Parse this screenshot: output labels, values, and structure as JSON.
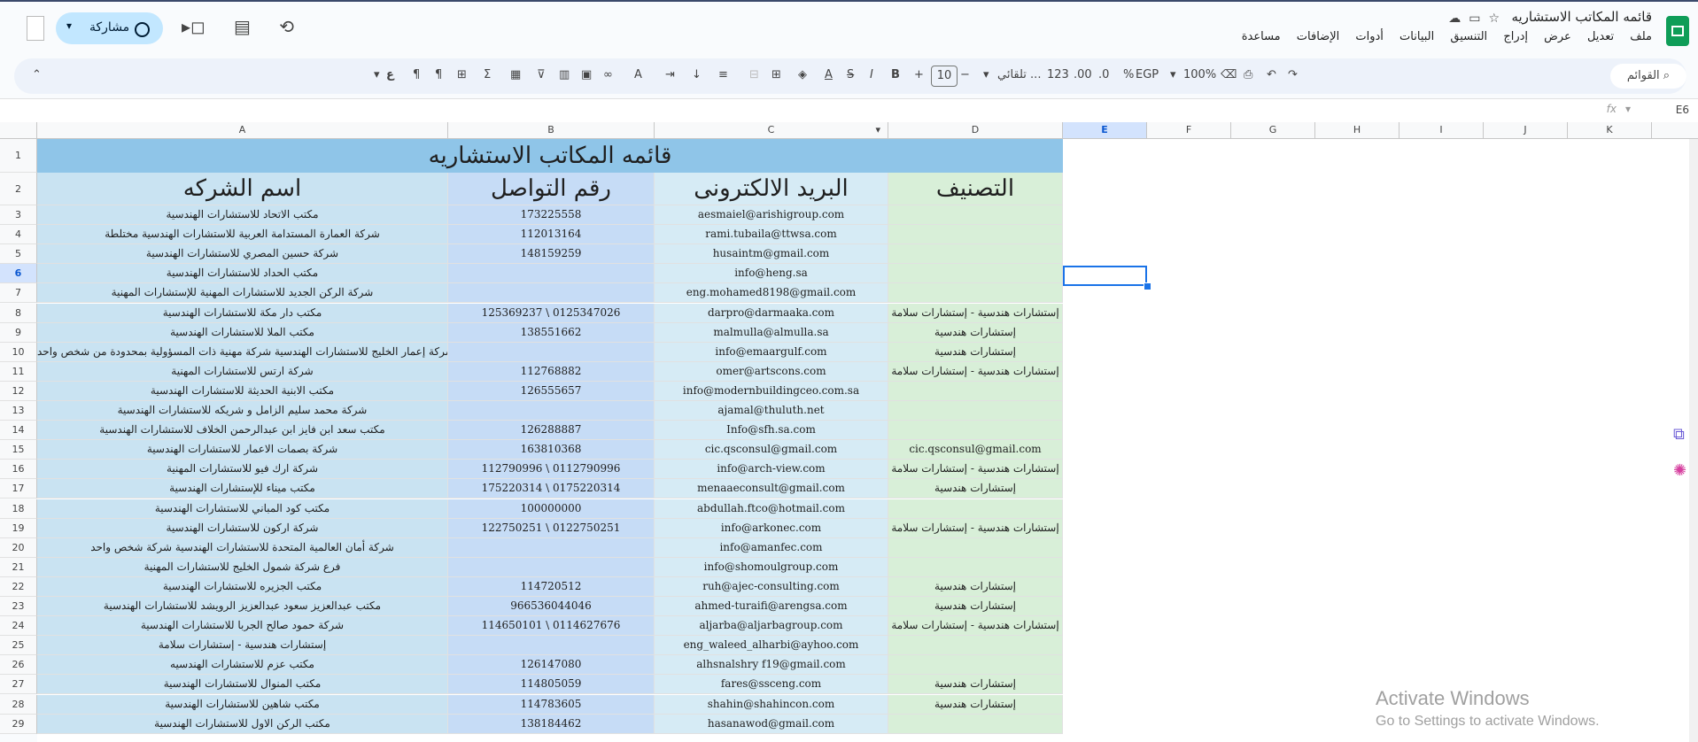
{
  "app": {
    "doc_title": "قائمه المكاتب الاستشاريه",
    "menus": [
      "ملف",
      "تعديل",
      "عرض",
      "إدراج",
      "التنسيق",
      "البيانات",
      "أدوات",
      "الإضافات",
      "مساعدة"
    ],
    "share_label": "مشاركة"
  },
  "toolbar": {
    "search_label": "القوائم",
    "zoom": "100%",
    "currency": "EGP",
    "percent": "%",
    "decimal_dec": ".0",
    "decimal_inc": ".00",
    "number_format": "123",
    "font": "تلقائي ...",
    "font_size": "10",
    "bold": "B",
    "italic": "I",
    "strike": "S",
    "text_color": "A",
    "sigma": "Σ",
    "plus": "+",
    "minus": "−"
  },
  "formula_bar": {
    "cell_ref": "E6",
    "fx": "fx"
  },
  "columns": [
    "A",
    "B",
    "C",
    "D",
    "E",
    "F",
    "G",
    "H",
    "I",
    "J",
    "K"
  ],
  "sheet": {
    "title": "قائمه المكاتب الاستشاريه",
    "headers": {
      "company": "اسم الشركه",
      "phone": "رقم التواصل",
      "email": "البريد الالكترونى",
      "category": "التصنيف"
    },
    "rows": [
      {
        "n": "3",
        "a": "مكتب الاتحاد للاستشارات الهندسية",
        "b": "173225558",
        "c": "aesmaiel@arishigroup.com",
        "d": ""
      },
      {
        "n": "4",
        "a": "شركة العمارة المستدامة العربية للاستشارات الهندسية مختلطة",
        "b": "112013164",
        "c": "rami.tubaila@ttwsa.com",
        "d": ""
      },
      {
        "n": "5",
        "a": "شركة حسين المصري للاستشارات الهندسية",
        "b": "148159259",
        "c": "husaintm@gmail.com",
        "d": ""
      },
      {
        "n": "6",
        "a": "مكتب الحداد للاستشارات الهندسية",
        "b": "",
        "c": "info@heng.sa",
        "d": ""
      },
      {
        "n": "7",
        "a": "شركة الركن الجديد للاستشارات المهنية للإستشارات المهنية",
        "b": "",
        "c": "eng.mohamed8198@gmail.com",
        "d": ""
      },
      {
        "n": "8",
        "a": "مكتب دار مكة للاستشارات الهندسية",
        "b": "125369237 \\ 0125347026",
        "c": "darpro@darmaaka.com",
        "d": "إستشارات هندسية - إستشارات سلامة"
      },
      {
        "n": "9",
        "a": "مكتب الملا للاستشارات الهندسية",
        "b": "138551662",
        "c": "malmulla@almulla.sa",
        "d": "إستشارات هندسية"
      },
      {
        "n": "10",
        "a": "شركة إعمار الخليج للاستشارات الهندسية شركة مهنية ذات المسؤولية بمحدودة من شخص واحد",
        "b": "",
        "c": "info@emaargulf.com",
        "d": "إستشارات هندسية"
      },
      {
        "n": "11",
        "a": "شركة ارتس للاستشارات المهنية",
        "b": "112768882",
        "c": "omer@artscons.com",
        "d": "إستشارات هندسية - إستشارات سلامة"
      },
      {
        "n": "12",
        "a": "مكتب الابنية الحديثة للاستشارات الهندسية",
        "b": "126555657",
        "c": "info@modernbuildingceo.com.sa",
        "d": ""
      },
      {
        "n": "13",
        "a": "شركة محمد سليم الزامل و شريكه للاستشارات الهندسية",
        "b": "",
        "c": "ajamal@thuluth.net",
        "d": ""
      },
      {
        "n": "14",
        "a": "مكتب سعد ابن فايز ابن عبدالرحمن الخلاف للاستشارات الهندسية",
        "b": "126288887",
        "c": "Info@sfh.sa.com",
        "d": ""
      },
      {
        "n": "15",
        "a": "شركة بصمات الاعمار للاستشارات الهندسية",
        "b": "163810368",
        "c": "cic.qsconsul@gmail.com",
        "d": "cic.qsconsul@gmail.com"
      },
      {
        "n": "16",
        "a": "شركة ارك فيو للاستشارات المهنية",
        "b": "112790996 \\ 0112790996",
        "c": "info@arch-view.com",
        "d": "إستشارات هندسية - إستشارات سلامة"
      },
      {
        "n": "17",
        "a": "مكتب ميناء للإستشارات الهندسية",
        "b": "175220314 \\ 0175220314",
        "c": "menaaeconsult@gmail.com",
        "d": "إستشارات هندسية"
      },
      {
        "n": "18",
        "a": "مكتب كود المباني للاستشارات الهندسية",
        "b": "100000000",
        "c": "abdullah.ftco@hotmail.com",
        "d": ""
      },
      {
        "n": "19",
        "a": "شركة اركون للاستشارات الهندسية",
        "b": "122750251 \\ 0122750251",
        "c": "info@arkonec.com",
        "d": "إستشارات هندسية - إستشارات سلامة"
      },
      {
        "n": "20",
        "a": "شركة أمان العالمية المتحدة للاستشارات الهندسية شركة شخص واحد",
        "b": "",
        "c": "info@amanfec.com",
        "d": ""
      },
      {
        "n": "21",
        "a": "فرع شركة شمول الخليج للاستشارات المهنية",
        "b": "",
        "c": "info@shomoulgroup.com",
        "d": ""
      },
      {
        "n": "22",
        "a": "مكتب الجزيره للاستشارات الهندسية",
        "b": "114720512",
        "c": "ruh@ajec-consulting.com",
        "d": "إستشارات هندسية"
      },
      {
        "n": "23",
        "a": "مكتب عبدالعزيز سعود عبدالعزيز الرويشد للاستشارات الهندسية",
        "b": "966536044046",
        "c": "ahmed-turaifi@arengsa.com",
        "d": "إستشارات هندسية"
      },
      {
        "n": "24",
        "a": "شركة حمود صالح الجربا للاستشارات الهندسية",
        "b": "114650101 \\ 0114627676",
        "c": "aljarba@aljarbagroup.com",
        "d": "إستشارات هندسية - إستشارات سلامة"
      },
      {
        "n": "25",
        "a": "إستشارات هندسية - إستشارات سلامة",
        "b": "",
        "c": "eng_waleed_alharbi@ayhoo.com",
        "d": ""
      },
      {
        "n": "26",
        "a": "مكتب عزم للاستشارات الهندسيه",
        "b": "126147080",
        "c": "alhsnalshry f19@gmail.com",
        "d": ""
      },
      {
        "n": "27",
        "a": "مكتب المنوال للاستشارات الهندسية",
        "b": "114805059",
        "c": "fares@ssceng.com",
        "d": "إستشارات هندسية"
      },
      {
        "n": "28",
        "a": "مكتب شاهين للاستشارات الهندسية",
        "b": "114783605",
        "c": "shahin@shahincon.com",
        "d": "إستشارات هندسية"
      },
      {
        "n": "29",
        "a": "مكتب الركن الاول للاستشارات الهندسية",
        "b": "138184462",
        "c": "hasanawod@gmail.com",
        "d": ""
      }
    ]
  },
  "watermark": {
    "line1": "Activate Windows",
    "line2": "Go to Settings to activate Windows."
  }
}
